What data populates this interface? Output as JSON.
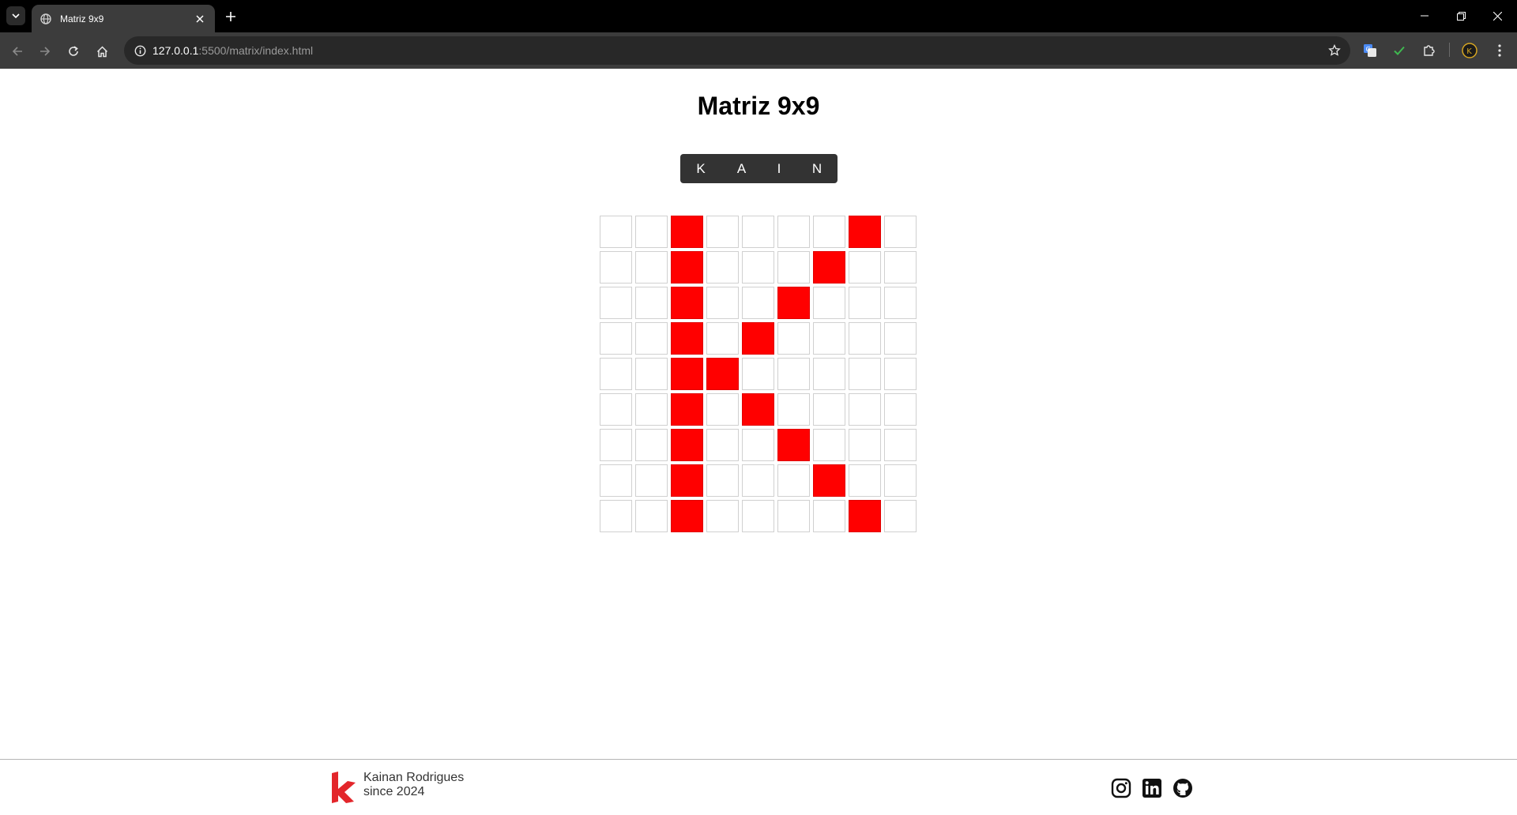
{
  "browser": {
    "tab_title": "Matriz 9x9",
    "url_host": "127.0.0.1",
    "url_rest": ":5500/matrix/index.html"
  },
  "page": {
    "title": "Matriz 9x9",
    "letters": [
      "K",
      "A",
      "I",
      "N"
    ],
    "selected_letter": "K",
    "on_color": "#ff0000",
    "matrix": [
      [
        0,
        0,
        1,
        0,
        0,
        0,
        0,
        1,
        0
      ],
      [
        0,
        0,
        1,
        0,
        0,
        0,
        1,
        0,
        0
      ],
      [
        0,
        0,
        1,
        0,
        0,
        1,
        0,
        0,
        0
      ],
      [
        0,
        0,
        1,
        0,
        1,
        0,
        0,
        0,
        0
      ],
      [
        0,
        0,
        1,
        1,
        0,
        0,
        0,
        0,
        0
      ],
      [
        0,
        0,
        1,
        0,
        1,
        0,
        0,
        0,
        0
      ],
      [
        0,
        0,
        1,
        0,
        0,
        1,
        0,
        0,
        0
      ],
      [
        0,
        0,
        1,
        0,
        0,
        0,
        1,
        0,
        0
      ],
      [
        0,
        0,
        1,
        0,
        0,
        0,
        0,
        1,
        0
      ]
    ]
  },
  "footer": {
    "name": "Kainan Rodrigues",
    "since": "since 2024",
    "brand_color": "#e3262b",
    "social_icons": [
      "instagram-icon",
      "linkedin-icon",
      "github-icon"
    ]
  }
}
